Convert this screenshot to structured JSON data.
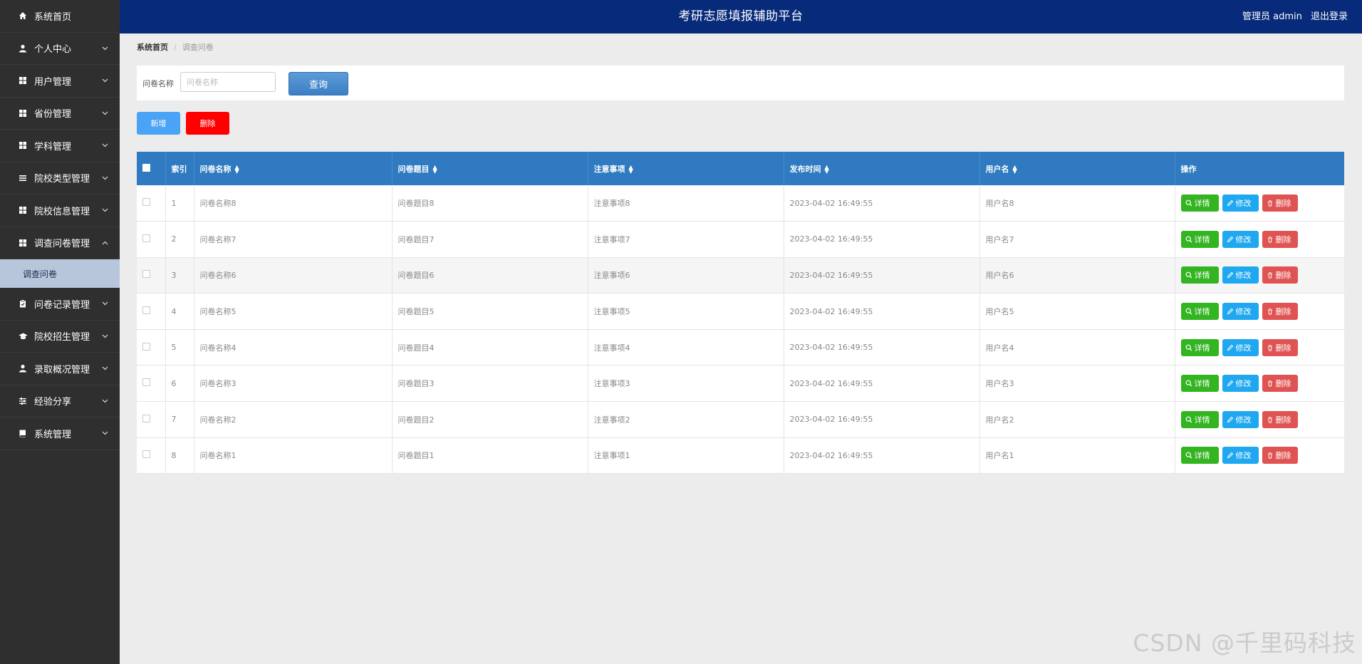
{
  "app": {
    "title": "考研志愿填报辅助平台",
    "user_label": "管理员 admin",
    "logout_label": "退出登录"
  },
  "sidebar": {
    "items": [
      {
        "label": "系统首页",
        "icon": "home-icon",
        "expanded": false,
        "has_children": false
      },
      {
        "label": "个人中心",
        "icon": "user-icon",
        "expanded": false,
        "has_children": true
      },
      {
        "label": "用户管理",
        "icon": "grid-icon",
        "expanded": false,
        "has_children": true
      },
      {
        "label": "省份管理",
        "icon": "grid-icon",
        "expanded": false,
        "has_children": true
      },
      {
        "label": "学科管理",
        "icon": "grid-icon",
        "expanded": false,
        "has_children": true
      },
      {
        "label": "院校类型管理",
        "icon": "list-icon",
        "expanded": false,
        "has_children": true
      },
      {
        "label": "院校信息管理",
        "icon": "grid-icon",
        "expanded": false,
        "has_children": true
      },
      {
        "label": "调查问卷管理",
        "icon": "grid-icon",
        "expanded": true,
        "has_children": true
      },
      {
        "label": "问卷记录管理",
        "icon": "clipboard-icon",
        "expanded": false,
        "has_children": true
      },
      {
        "label": "院校招生管理",
        "icon": "graduation-icon",
        "expanded": false,
        "has_children": true
      },
      {
        "label": "录取概况管理",
        "icon": "user-icon",
        "expanded": false,
        "has_children": true
      },
      {
        "label": "经验分享",
        "icon": "sliders-icon",
        "expanded": false,
        "has_children": true
      },
      {
        "label": "系统管理",
        "icon": "book-icon",
        "expanded": false,
        "has_children": true
      }
    ],
    "subitem": {
      "label": "调查问卷"
    }
  },
  "breadcrumb": {
    "home": "系统首页",
    "separator": "/",
    "current": "调查问卷"
  },
  "search": {
    "label": "问卷名称",
    "placeholder": "问卷名称",
    "value": "",
    "button_label": "查询"
  },
  "actions": {
    "add_label": "新增",
    "delete_label": "删除"
  },
  "table": {
    "columns": [
      "索引",
      "问卷名称",
      "问卷题目",
      "注意事项",
      "发布时间",
      "用户名",
      "操作"
    ],
    "rows": [
      {
        "index": "1",
        "name": "问卷名称8",
        "topic": "问卷题目8",
        "notes": "注意事项8",
        "time": "2023-04-02 16:49:55",
        "username": "用户名8"
      },
      {
        "index": "2",
        "name": "问卷名称7",
        "topic": "问卷题目7",
        "notes": "注意事项7",
        "time": "2023-04-02 16:49:55",
        "username": "用户名7"
      },
      {
        "index": "3",
        "name": "问卷名称6",
        "topic": "问卷题目6",
        "notes": "注意事项6",
        "time": "2023-04-02 16:49:55",
        "username": "用户名6"
      },
      {
        "index": "4",
        "name": "问卷名称5",
        "topic": "问卷题目5",
        "notes": "注意事项5",
        "time": "2023-04-02 16:49:55",
        "username": "用户名5"
      },
      {
        "index": "5",
        "name": "问卷名称4",
        "topic": "问卷题目4",
        "notes": "注意事项4",
        "time": "2023-04-02 16:49:55",
        "username": "用户名4"
      },
      {
        "index": "6",
        "name": "问卷名称3",
        "topic": "问卷题目3",
        "notes": "注意事项3",
        "time": "2023-04-02 16:49:55",
        "username": "用户名3"
      },
      {
        "index": "7",
        "name": "问卷名称2",
        "topic": "问卷题目2",
        "notes": "注意事项2",
        "time": "2023-04-02 16:49:55",
        "username": "用户名2"
      },
      {
        "index": "8",
        "name": "问卷名称1",
        "topic": "问卷题目1",
        "notes": "注意事项1",
        "time": "2023-04-02 16:49:55",
        "username": "用户名1"
      }
    ],
    "row_actions": {
      "detail": "详情",
      "edit": "修改",
      "delete": "删除"
    }
  },
  "watermark": "CSDN @千里码科技",
  "colors": {
    "header_bg": "#072b7a",
    "sidebar_bg": "#2f2f2f",
    "table_header_bg": "#2f7ac0",
    "detail_btn": "#33b421",
    "edit_btn": "#1fa8f0",
    "delete_btn": "#e05353",
    "add_btn": "#4aa3f5",
    "bulk_delete_btn": "#ff0000"
  }
}
